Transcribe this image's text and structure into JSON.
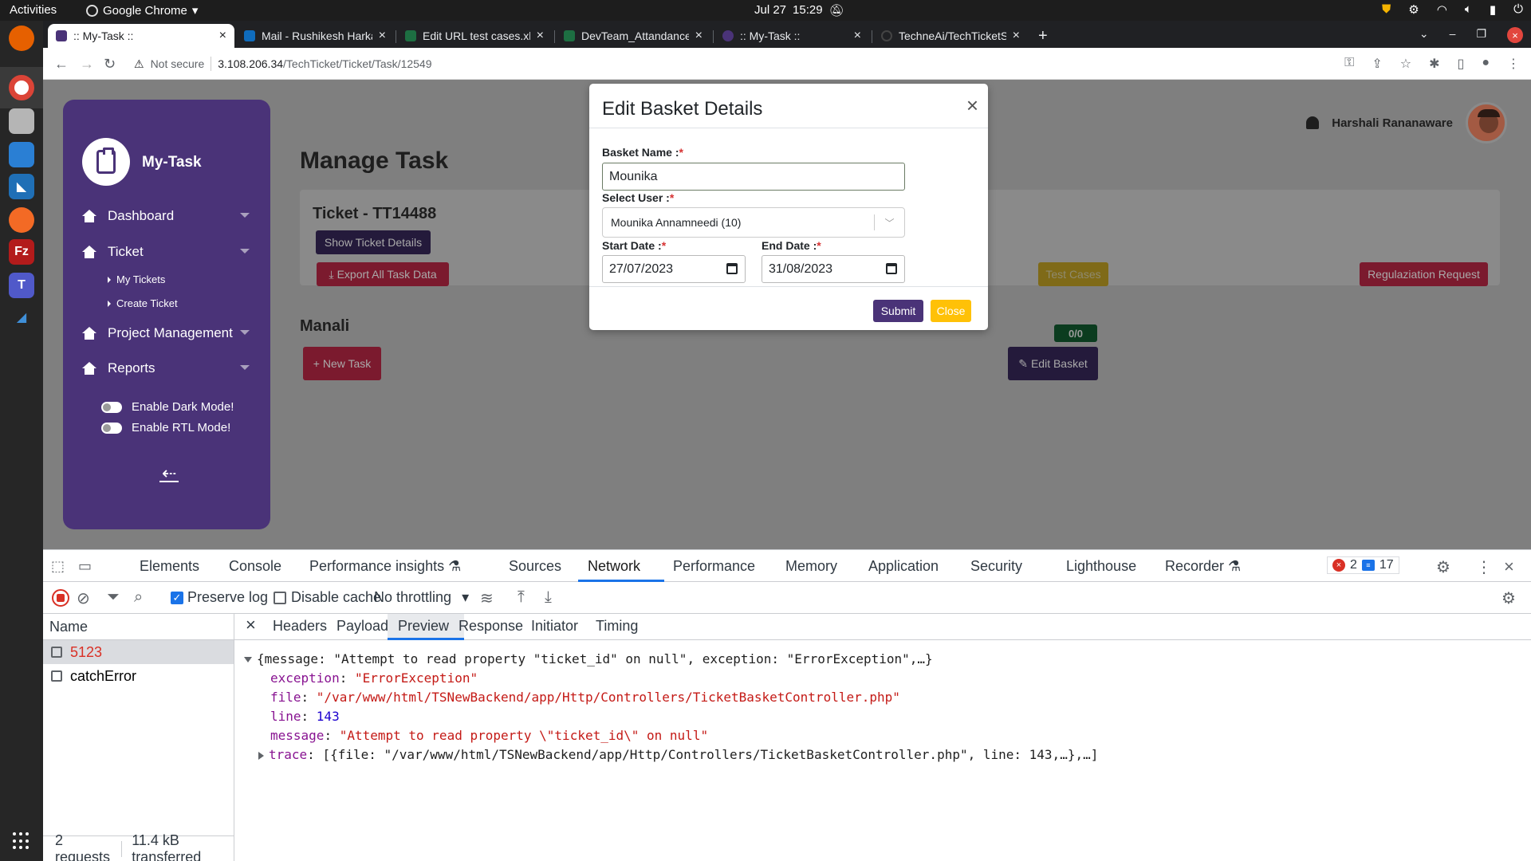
{
  "os": {
    "activities": "Activities",
    "app_menu": "Google Chrome",
    "date": "Jul 27",
    "time": "15:29"
  },
  "browser": {
    "tabs": [
      {
        "title": ":: My-Task ::",
        "active": true
      },
      {
        "title": "Mail - Rushikesh Harkare -",
        "active": false
      },
      {
        "title": "Edit URL test cases.xlsx",
        "active": false
      },
      {
        "title": "DevTeam_Attandance.xls",
        "active": false
      },
      {
        "title": ":: My-Task ::",
        "active": false
      },
      {
        "title": "TechneAi/TechTicketSoft",
        "active": false
      }
    ],
    "security_label": "Not secure",
    "url_host": "3.108.206.34",
    "url_path": "/TechTicket/Ticket/Task/12549"
  },
  "sidebar": {
    "brand": "My-Task",
    "menu": [
      {
        "label": "Dashboard"
      },
      {
        "label": "Ticket",
        "sub": [
          "My Tickets",
          "Create Ticket"
        ]
      },
      {
        "label": "Project Management"
      },
      {
        "label": "Reports"
      }
    ],
    "toggles": [
      "Enable Dark Mode!",
      "Enable RTL Mode!"
    ]
  },
  "user": {
    "name": "Harshali Rananaware"
  },
  "main": {
    "title": "Manage Task",
    "ticket_title": "Ticket - TT14488",
    "show_ticket_btn": "Show Ticket Details",
    "export_btn": "Export All Task Data",
    "test_cases_btn": "Test Cases",
    "regularization_btn": "Regulaziation Request",
    "basket_name": "Manali",
    "new_task_btn": "New Task",
    "count_badge": "0/0",
    "edit_basket_btn": "Edit Basket"
  },
  "modal": {
    "title": "Edit Basket Details",
    "basket_name_label": "Basket Name :",
    "basket_name_value": "Mounika",
    "select_user_label": "Select User :",
    "select_user_value": "Mounika Annamneedi (10)",
    "start_date_label": "Start Date :",
    "start_date_value": "27/07/2023",
    "end_date_label": "End Date :",
    "end_date_value": "31/08/2023",
    "required_mark": "*",
    "submit_btn": "Submit",
    "close_btn": "Close"
  },
  "devtools": {
    "tabs": [
      "Elements",
      "Console",
      "Performance insights",
      "Sources",
      "Network",
      "Performance",
      "Memory",
      "Application",
      "Security",
      "Lighthouse",
      "Recorder"
    ],
    "active_tab": "Network",
    "error_count": "2",
    "message_count": "17",
    "toolbar": {
      "preserve_log": "Preserve log",
      "disable_cache": "Disable cache",
      "throttling": "No throttling"
    },
    "name_header": "Name",
    "requests": [
      {
        "name": "5123",
        "error": true
      },
      {
        "name": "catchError",
        "error": false
      }
    ],
    "status_requests": "2 requests",
    "status_transferred": "11.4 kB transferred",
    "detail_tabs": [
      "Headers",
      "Payload",
      "Preview",
      "Response",
      "Initiator",
      "Timing"
    ],
    "active_detail_tab": "Preview",
    "preview": {
      "summary": "{message: \"Attempt to read property \"ticket_id\" on null\", exception: \"ErrorException\",…}",
      "exception_key": "exception",
      "exception_val": "\"ErrorException\"",
      "file_key": "file",
      "file_val": "\"/var/www/html/TSNewBackend/app/Http/Controllers/TicketBasketController.php\"",
      "line_key": "line",
      "line_val": "143",
      "message_key": "message",
      "message_val": "\"Attempt to read property \\\"ticket_id\\\" on null\"",
      "trace_key": "trace",
      "trace_val": "[{file: \"/var/www/html/TSNewBackend/app/Http/Controllers/TicketBasketController.php\", line: 143,…},…]"
    }
  }
}
